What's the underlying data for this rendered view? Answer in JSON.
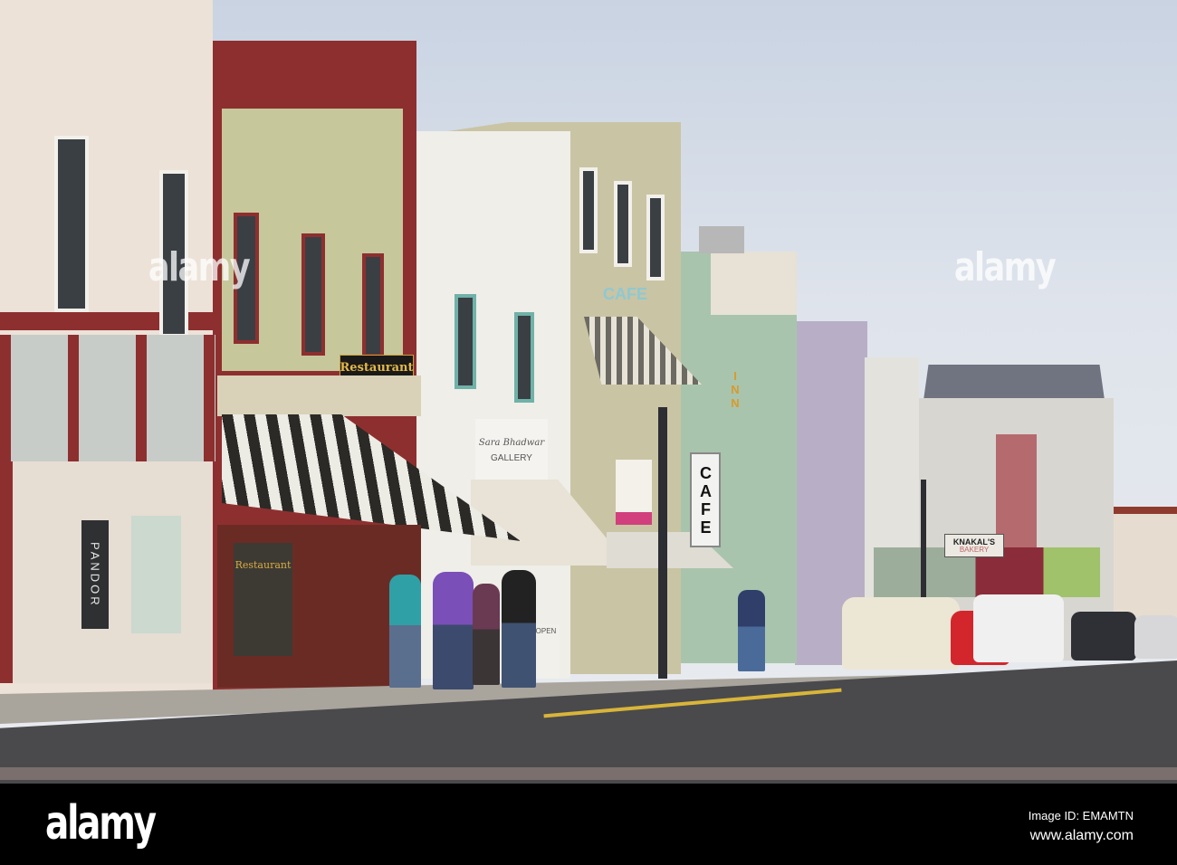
{
  "photo": {
    "signs": {
      "restaurant_hanging": "Restaurant",
      "restaurant_window": "Restaurant",
      "cafe_wall": "CAFE",
      "cafe_vertical": "CAFE",
      "gallery": "GALLERY",
      "gallery_script": "Sara Bhadwar",
      "pandora": "PANDOR",
      "open": "OPEN",
      "inn": "INN",
      "knakals_line1": "KNAKAL'S",
      "knakals_line2": "BAKERY"
    },
    "watermark": "alamy"
  },
  "footer": {
    "logo": "alamy",
    "image_id": "Image ID: EMAMTN",
    "url": "www.alamy.com"
  },
  "colors": {
    "brick_red": "#8e2f2f",
    "road": "#4a4a4c",
    "awning_stripe": "#2b2a26"
  }
}
